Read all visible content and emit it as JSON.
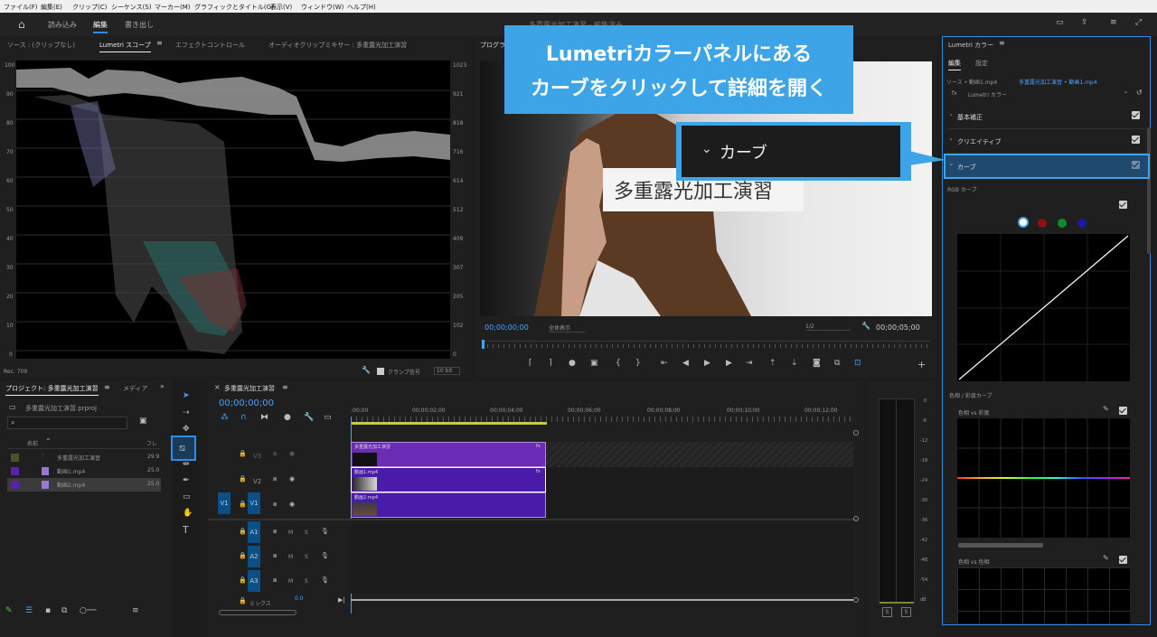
{
  "menubar": [
    "ファイル(F)",
    "編集(E)",
    "クリップ(C)",
    "シーケンス(S)",
    "マーカー(M)",
    "グラフィックとタイトル(G)",
    "表示(V)",
    "ウィンドウ(W)",
    "ヘルプ(H)"
  ],
  "workspace": {
    "tabs": [
      "読み込み",
      "編集",
      "書き出し"
    ],
    "active": "編集",
    "title": "多重露光加工演習 - 編集済み"
  },
  "scopes_panel": {
    "tabs": [
      "ソース : (クリップなし)",
      "Lumetri スコープ",
      "エフェクトコントロール",
      "オーディオクリップミキサー : 多重露光加工演習"
    ],
    "left_ticks": [
      "100",
      "90",
      "80",
      "70",
      "60",
      "50",
      "40",
      "30",
      "20",
      "10",
      "0"
    ],
    "right_ticks": [
      "1023",
      "921",
      "818",
      "716",
      "614",
      "512",
      "409",
      "307",
      "205",
      "102",
      "0"
    ],
    "footer_left": "Rec. 709",
    "clamp_label": "クランプ信号",
    "bit_value": "10 bit"
  },
  "program_monitor": {
    "tab": "プログラム",
    "title_text": "多重露光加工演習",
    "timecode_left": "00;00;00;00",
    "fit": "全体表示",
    "quality": "1/2",
    "timecode_right": "00;00;05;00"
  },
  "project_panel": {
    "tabs": [
      "プロジェクト: 多重露光加工演習",
      "メディア"
    ],
    "file": "多重露光加工演習.prproj",
    "col_name": "名前",
    "col_fr": "フレ",
    "items": [
      {
        "name": "多重露光加工演習",
        "fr": "29.9",
        "color": "#4a5226"
      },
      {
        "name": "動画1.mp4",
        "fr": "25.0",
        "color": "#5a22a8"
      },
      {
        "name": "動画2.mp4",
        "fr": "25.0",
        "color": "#5a22a8"
      }
    ]
  },
  "timeline": {
    "tab": "多重露光加工演習",
    "timecode": "00;00;00;00",
    "ruler": [
      ":00;00",
      "00;00;02;00",
      "00;00;04;00",
      "00;00;06;00",
      "00;00;08;00",
      "00;00;10;00",
      "00;00;12;00"
    ],
    "video_tracks": [
      "V3",
      "V2",
      "V1"
    ],
    "source_tracks": [
      "V1",
      "A1",
      "A2",
      "A3"
    ],
    "audio_tracks": [
      "A1",
      "A2",
      "A3"
    ],
    "mix_label": "ミックス",
    "mix_value": "0.0",
    "clips": {
      "v3": "多重露光加工演習",
      "v2": "動画1.mp4",
      "v1": "動画2.mp4"
    },
    "fx": "fx",
    "m": "M",
    "s": "S"
  },
  "audio_meter": {
    "ticks": [
      "0",
      "-6",
      "-12",
      "-18",
      "-24",
      "-30",
      "-36",
      "-42",
      "-48",
      "-54",
      "dB"
    ],
    "buttons": [
      "S",
      "S"
    ]
  },
  "lumetri": {
    "title": "Lumetri カラー",
    "subtabs": [
      "編集",
      "設定"
    ],
    "source": "ソース • 動画1.mp4",
    "target": "多重露光加工演習 • 動画1.mp4",
    "fx_item": "Lumetri カラー",
    "sections": [
      "基本補正",
      "クリエイティブ",
      "カーブ"
    ],
    "rgb_curve": "RGB カーブ",
    "hue_sat": "色相 / 彩度カーブ",
    "hue_vs_sat": "色相 vs 彩度",
    "hue_vs_hue": "色相 vs 色相"
  },
  "callout": {
    "line1": "Lumetriカラーパネルにある",
    "line2": "カーブをクリックして詳細を開く",
    "zoom_label": "カーブ"
  },
  "colors": {
    "accent": "#2d8ceb",
    "callout": "#3da4e8",
    "clip_purple": "#6a2bb5",
    "clip_violet": "#4a1aa8"
  }
}
